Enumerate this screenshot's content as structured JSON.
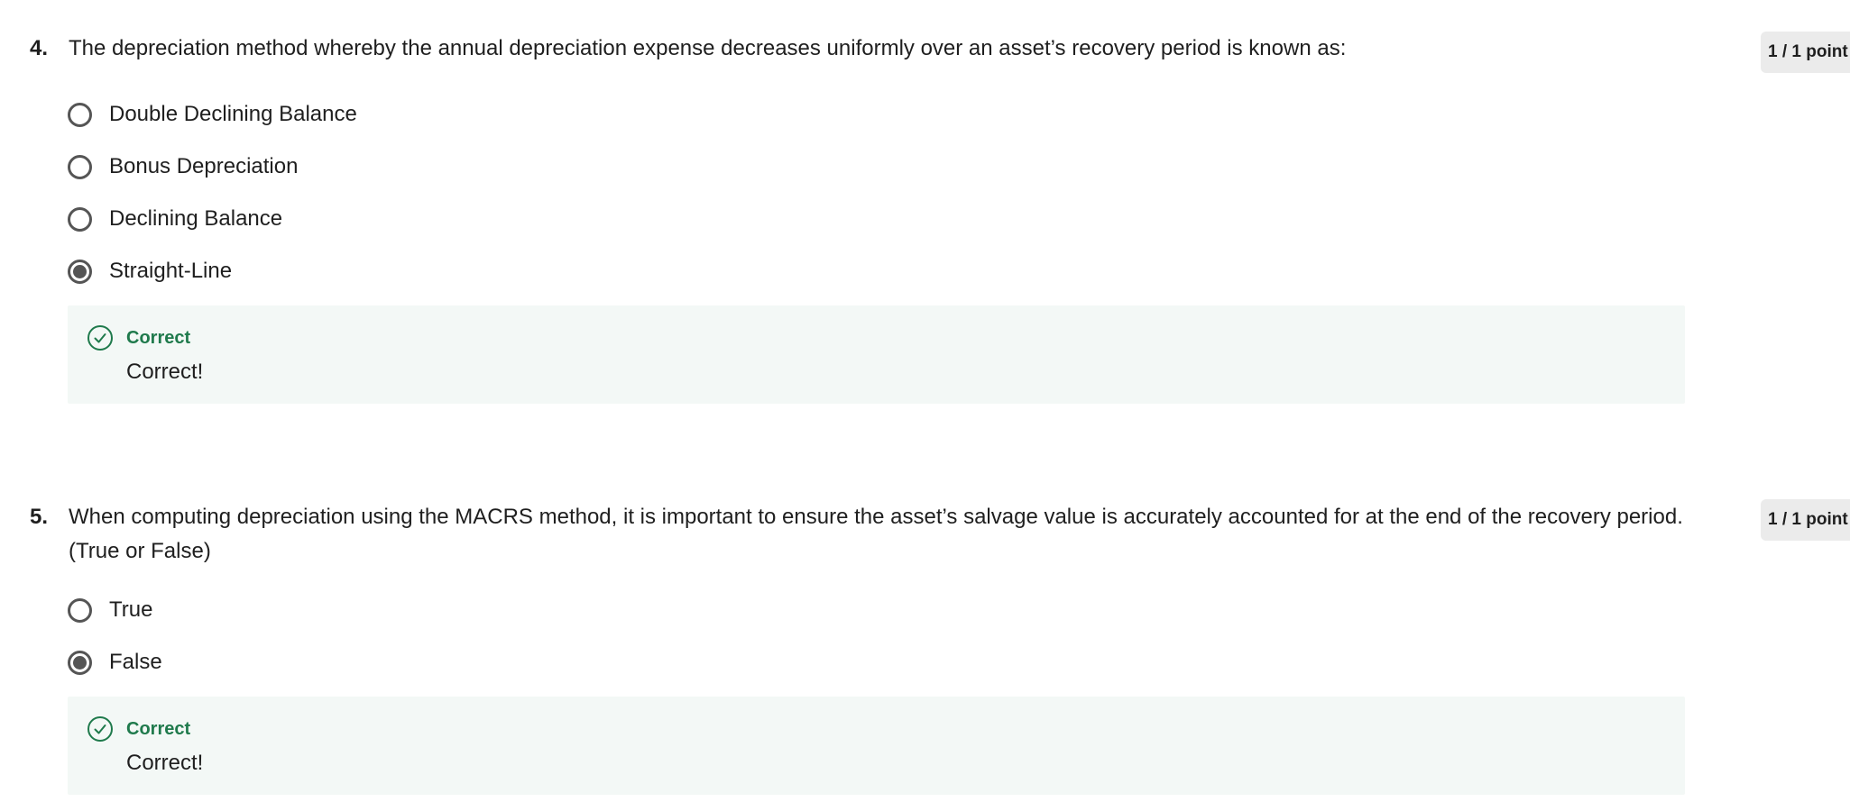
{
  "questions": [
    {
      "number": "4.",
      "text": "The depreciation method whereby the annual depreciation expense decreases uniformly over an asset’s recovery period is known as:",
      "points": "1 / 1 point",
      "options": [
        {
          "label": "Double Declining Balance",
          "selected": false
        },
        {
          "label": "Bonus Depreciation",
          "selected": false
        },
        {
          "label": "Declining Balance",
          "selected": false
        },
        {
          "label": "Straight-Line",
          "selected": true
        }
      ],
      "feedback": {
        "title": "Correct",
        "message": "Correct!",
        "icon": "check-circle-icon"
      }
    },
    {
      "number": "5.",
      "text": "When computing depreciation using the MACRS method, it is important to ensure the asset’s salvage value is accurately accounted for at the end of the recovery period. (True or False)",
      "points": "1 / 1 point",
      "options": [
        {
          "label": "True",
          "selected": false
        },
        {
          "label": "False",
          "selected": true
        }
      ],
      "feedback": {
        "title": "Correct",
        "message": "Correct!",
        "icon": "check-circle-icon"
      }
    }
  ],
  "colors": {
    "correct_green": "#1f7a4c",
    "feedback_bg": "#f3f8f6",
    "radio": "#555555",
    "badge_bg": "#ebebeb"
  }
}
